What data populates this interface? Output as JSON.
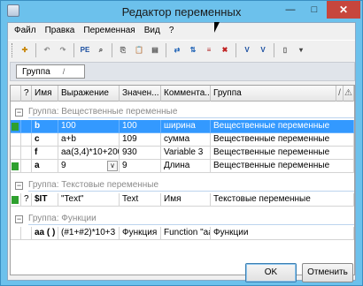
{
  "window": {
    "title": "Редактор переменных",
    "minimize_glyph": "—",
    "maximize_glyph": "□",
    "close_glyph": "✕"
  },
  "menu": [
    "Файл",
    "Правка",
    "Переменная",
    "Вид",
    "?"
  ],
  "toolbar": {
    "icons": [
      "add-variable-icon",
      "undo-icon",
      "redo-icon",
      "import-icon",
      "find-icon",
      "copy-icon",
      "paste-icon",
      "variable-properties-icon",
      "move-variable-icon",
      "sort-icon",
      "insert-icon",
      "delete-icon",
      "add-var-icon",
      "var-settings-icon",
      "new-document-icon",
      "options-icon"
    ],
    "var_label": "VAR"
  },
  "group_panel": {
    "chip_label": "Группа",
    "chip_sort": "/"
  },
  "columns": [
    "",
    "?",
    "Имя",
    "Выражение",
    "Значен...",
    "Коммента...",
    "Группа",
    "/",
    "⚠"
  ],
  "groups": [
    {
      "label": "Группа: Вещественные переменные",
      "toggle": "−",
      "rows": [
        {
          "flag": true,
          "q": "",
          "name": "b",
          "expr": "100",
          "value": "100",
          "comment": "ширина",
          "group": "Вещественные переменные",
          "selected": true
        },
        {
          "flag": false,
          "q": "",
          "name": "c",
          "expr": "a+b",
          "value": "109",
          "comment": "сумма",
          "group": "Вещественные переменные",
          "selected": false
        },
        {
          "flag": false,
          "q": "",
          "name": "f",
          "expr": "aa(3,4)*10+200",
          "value": "930",
          "comment": "Variable 3",
          "group": "Вещественные переменные",
          "selected": false
        },
        {
          "flag": true,
          "q": "",
          "name": "a",
          "expr": "9",
          "value": "9",
          "comment": "Длина",
          "group": "Вещественные переменные",
          "selected": false,
          "combo": true
        }
      ]
    },
    {
      "label": "Группа: Текстовые переменные",
      "toggle": "−",
      "rows": [
        {
          "flag": true,
          "q": "?",
          "name": "$IT",
          "expr": "\"Text\"",
          "value": "Text",
          "comment": "Имя",
          "group": "Текстовые переменные",
          "selected": false
        }
      ]
    },
    {
      "label": "Группа: Функции",
      "toggle": "−",
      "rows": [
        {
          "flag": false,
          "q": "",
          "name": "aa ( )",
          "expr": "(#1+#2)*10+3",
          "value": "Функция",
          "comment": "Function \"aa\"",
          "group": "Функции",
          "selected": false
        }
      ]
    }
  ],
  "buttons": {
    "ok": "OK",
    "cancel": "Отменить"
  },
  "colors": {
    "selection": "#3399ff",
    "flag": "#2ea02e",
    "title_bar": "#6cc1ec",
    "close": "#c7463d"
  }
}
